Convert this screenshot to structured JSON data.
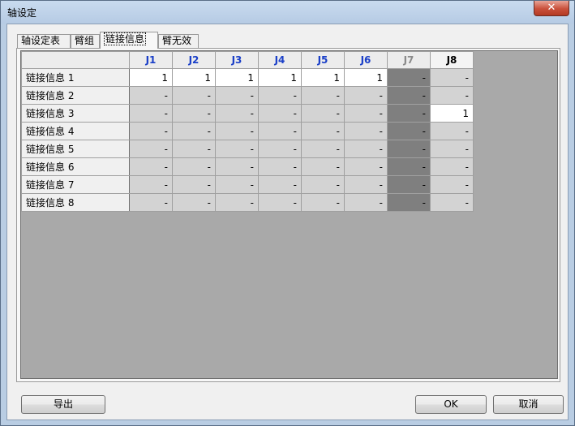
{
  "window": {
    "title": "轴设定",
    "close_label": "✕"
  },
  "tabs": [
    {
      "label": "轴设定表"
    },
    {
      "label": "臂组"
    },
    {
      "label": "链接信息"
    },
    {
      "label": "臂无效"
    }
  ],
  "grid": {
    "columns": [
      "J1",
      "J2",
      "J3",
      "J4",
      "J5",
      "J6",
      "J7",
      "J8"
    ],
    "rows": [
      {
        "label": "链接信息 1",
        "cells": [
          "1",
          "1",
          "1",
          "1",
          "1",
          "1",
          "-",
          "-"
        ]
      },
      {
        "label": "链接信息 2",
        "cells": [
          "-",
          "-",
          "-",
          "-",
          "-",
          "-",
          "-",
          "-"
        ]
      },
      {
        "label": "链接信息 3",
        "cells": [
          "-",
          "-",
          "-",
          "-",
          "-",
          "-",
          "-",
          "1"
        ]
      },
      {
        "label": "链接信息 4",
        "cells": [
          "-",
          "-",
          "-",
          "-",
          "-",
          "-",
          "-",
          "-"
        ]
      },
      {
        "label": "链接信息 5",
        "cells": [
          "-",
          "-",
          "-",
          "-",
          "-",
          "-",
          "-",
          "-"
        ]
      },
      {
        "label": "链接信息 6",
        "cells": [
          "-",
          "-",
          "-",
          "-",
          "-",
          "-",
          "-",
          "-"
        ]
      },
      {
        "label": "链接信息 7",
        "cells": [
          "-",
          "-",
          "-",
          "-",
          "-",
          "-",
          "-",
          "-"
        ]
      },
      {
        "label": "链接信息 8",
        "cells": [
          "-",
          "-",
          "-",
          "-",
          "-",
          "-",
          "-",
          "-"
        ]
      }
    ]
  },
  "buttons": {
    "export": "导出",
    "ok": "OK",
    "cancel": "取消"
  }
}
